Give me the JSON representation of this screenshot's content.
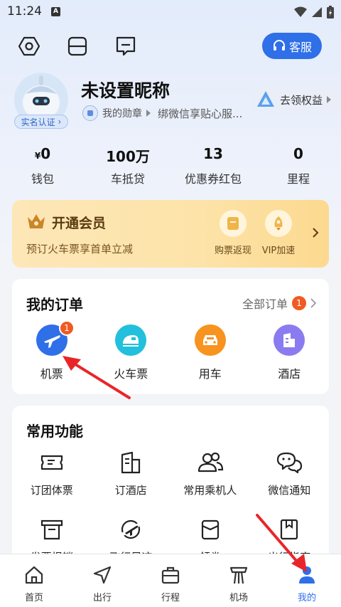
{
  "status_bar": {
    "time": "11:24",
    "notif_letter": "A"
  },
  "header": {
    "service_label": "客服"
  },
  "profile": {
    "nickname": "未设置昵称",
    "verify_label": "实名认证",
    "medal_label": "我的勋章",
    "wechat_hint": "绑微信享贴心服...",
    "rights_label": "去领权益"
  },
  "stats": [
    {
      "prefix": "¥",
      "value": "0",
      "label": "钱包"
    },
    {
      "prefix": "",
      "value": "100万",
      "label": "车抵贷"
    },
    {
      "prefix": "",
      "value": "13",
      "label": "优惠券红包"
    },
    {
      "prefix": "",
      "value": "0",
      "label": "里程"
    }
  ],
  "vip": {
    "title": "开通会员",
    "subtitle": "预订火车票享首单立减",
    "perks": [
      {
        "label": "购票返现"
      },
      {
        "label": "VIP加速"
      }
    ]
  },
  "orders": {
    "title": "我的订单",
    "all_label": "全部订单",
    "all_badge": "1",
    "items": [
      {
        "label": "机票",
        "icon": "plane-icon",
        "color": "#2f6fe8",
        "badge": "1"
      },
      {
        "label": "火车票",
        "icon": "train-icon",
        "color": "#22c0dc",
        "badge": ""
      },
      {
        "label": "用车",
        "icon": "car-icon",
        "color": "#f7931e",
        "badge": ""
      },
      {
        "label": "酒店",
        "icon": "hotel-icon",
        "color": "#8a7cf0",
        "badge": ""
      }
    ]
  },
  "functions": {
    "title": "常用功能",
    "items": [
      {
        "label": "订团体票",
        "icon": "ticket-icon"
      },
      {
        "label": "订酒店",
        "icon": "hotel-building-icon"
      },
      {
        "label": "常用乘机人",
        "icon": "passengers-icon"
      },
      {
        "label": "微信通知",
        "icon": "wechat-icon"
      },
      {
        "label": "发票报销",
        "icon": "invoice-icon"
      },
      {
        "label": "飞行足迹",
        "icon": "flight-trace-icon"
      },
      {
        "label": "领券",
        "icon": "coupon-icon"
      },
      {
        "label": "出行指南",
        "icon": "guide-icon"
      }
    ]
  },
  "tabbar": [
    {
      "label": "首页",
      "icon": "home-icon"
    },
    {
      "label": "出行",
      "icon": "travel-icon"
    },
    {
      "label": "行程",
      "icon": "trip-icon"
    },
    {
      "label": "机场",
      "icon": "airport-icon"
    },
    {
      "label": "我的",
      "icon": "profile-icon",
      "active": true
    }
  ],
  "colors": {
    "accent": "#2f6fe8",
    "badge_red": "#f05a23",
    "arrow_red": "#e8262a"
  }
}
